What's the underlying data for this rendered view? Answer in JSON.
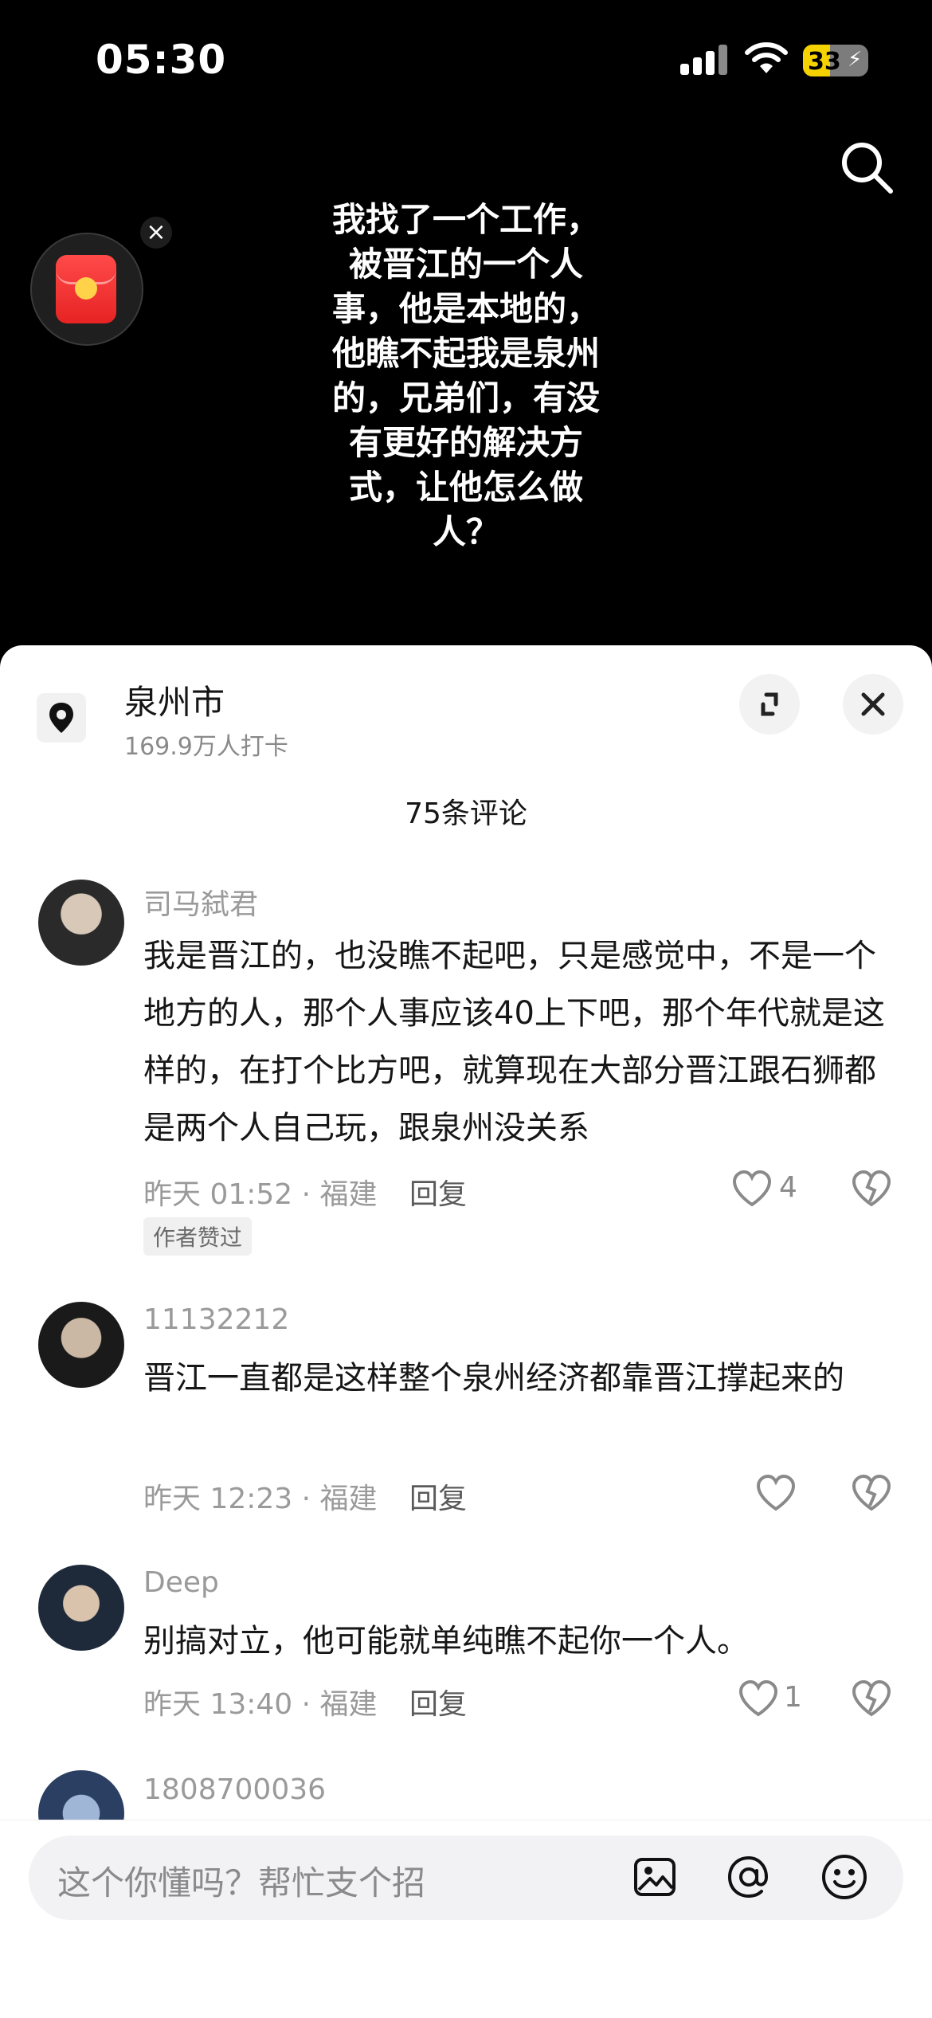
{
  "status_bar": {
    "time": "05:30",
    "battery": "33"
  },
  "video": {
    "caption": "我找了一个工作，被晋江的一个人事，他是本地的，他瞧不起我是泉州的，兄弟们，有没有更好的解决方式，让他怎么做人？"
  },
  "location": {
    "name": "泉州市",
    "checkins": "169.9万人打卡"
  },
  "comments_header": "75条评论",
  "comments": [
    {
      "username": "司马弑君",
      "text": "我是晋江的，也没瞧不起吧，只是感觉中，不是一个地方的人，那个人事应该40上下吧，那个年代就是这样的，在打个比方吧，就算现在大部分晋江跟石狮都是两个人自己玩，跟泉州没关系",
      "time_location": "昨天 01:52 · 福建",
      "reply": "回复",
      "likes": "4",
      "badge": "作者赞过"
    },
    {
      "username": "11132212",
      "text": "晋江一直都是这样整个泉州经济都靠晋江撑起来的",
      "time_location": "昨天 12:23 · 福建",
      "reply": "回复",
      "likes": ""
    },
    {
      "username": "Deep",
      "text": "别搞对立，他可能就单纯瞧不起你一个人。",
      "time_location": "昨天 13:40 · 福建",
      "reply": "回复",
      "likes": "1"
    },
    {
      "username": "1808700036"
    }
  ],
  "input": {
    "placeholder": "这个你懂吗？帮忙支个招"
  },
  "icons": {
    "search": "search-icon",
    "location": "location-pin-icon",
    "expand": "expand-icon",
    "close": "close-icon",
    "heart": "heart-icon",
    "broken_heart": "broken-heart-icon",
    "image": "image-icon",
    "at": "at-icon",
    "emoji": "emoji-icon"
  }
}
